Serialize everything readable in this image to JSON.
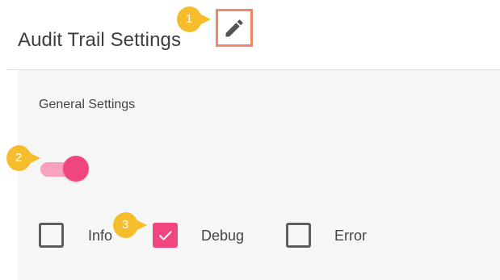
{
  "header": {
    "title": "Audit Trail Settings",
    "edit_icon": "pencil-icon"
  },
  "panel": {
    "section_title": "General Settings",
    "toggle": {
      "on": true,
      "track_color": "#f8a2c0",
      "thumb_color": "#f0457e"
    },
    "checkboxes": [
      {
        "label": "Info",
        "checked": false
      },
      {
        "label": "Debug",
        "checked": true
      },
      {
        "label": "Error",
        "checked": false
      }
    ]
  },
  "callouts": [
    {
      "number": "1"
    },
    {
      "number": "2"
    },
    {
      "number": "3"
    }
  ],
  "colors": {
    "accent": "#f0457e",
    "callout": "#f5bd2b",
    "edit_highlight": "#f0876a",
    "panel_bg": "#f6f6f6"
  }
}
